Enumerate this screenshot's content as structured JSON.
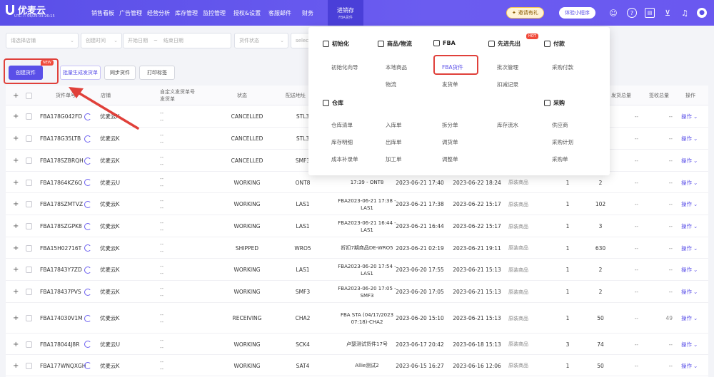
{
  "header": {
    "brand": "优麦云",
    "subtitle": "UTC-7: 06/26 03:26:15",
    "nav": [
      {
        "label": "销售看板"
      },
      {
        "label": "广告管理"
      },
      {
        "label": "经营分析"
      },
      {
        "label": "库存管理"
      },
      {
        "label": "监控管理"
      },
      {
        "label": "授权&设置"
      },
      {
        "label": "客服邮件"
      },
      {
        "label": "财务"
      }
    ],
    "active_nav": {
      "label": "进销存",
      "sub": "FBA货件"
    },
    "invite_label": "邀请有礼",
    "trial_label": "体验小程序"
  },
  "filters": [
    {
      "placeholder": "请选择店铺"
    },
    {
      "placeholder": "创建时间"
    },
    {
      "placeholder": "开始日期"
    },
    {
      "placeholder": "结束日期"
    },
    {
      "placeholder": "货件状态"
    },
    {
      "placeholder": "selec"
    }
  ],
  "toolbar": {
    "create_label": "创建货件",
    "new_badge": "NEW",
    "batch_label": "批量生成发货单",
    "sync_label": "同步货件",
    "print_label": "打印标签"
  },
  "table": {
    "headers": {
      "shipment_no": "货件单号",
      "store": "店铺",
      "custom": "自定义发货单号",
      "ship_no": "发货单",
      "status": "状态",
      "dest": "配送地址",
      "ship_total": "发货总量",
      "recv_total": "签收总量",
      "ops": "操作"
    },
    "rows": [
      {
        "id": "FBA178G042FD",
        "store": "优麦云K",
        "status": "CANCELLED",
        "dest": "STL3",
        "name": "",
        "created": "",
        "updated": "",
        "type": "",
        "c1": "",
        "c2": "",
        "ship": "--",
        "recv": "--"
      },
      {
        "id": "FBA178G35LTB",
        "store": "优麦云K",
        "status": "CANCELLED",
        "dest": "STL3",
        "name": "",
        "created": "",
        "updated": "",
        "type": "",
        "c1": "",
        "c2": "",
        "ship": "--",
        "recv": "--"
      },
      {
        "id": "FBA178SZBRQH",
        "store": "优麦云K",
        "status": "CANCELLED",
        "dest": "SMF3",
        "name": "",
        "created": "",
        "updated": "",
        "type": "",
        "c1": "",
        "c2": "",
        "ship": "--",
        "recv": "--"
      },
      {
        "id": "FBA17864KZ6Q",
        "store": "优麦云U",
        "status": "WORKING",
        "dest": "ONT8",
        "name": "17:39 - ONT8",
        "created": "2023-06-21 17:40",
        "updated": "2023-06-22 18:24",
        "type": "原装商品",
        "c1": "1",
        "c2": "2",
        "ship": "--",
        "recv": "--"
      },
      {
        "id": "FBA178SZMTVZ",
        "store": "优麦云K",
        "status": "WORKING",
        "dest": "LAS1",
        "name": "FBA2023-06-21 17:38 - LAS1",
        "created": "2023-06-21 17:38",
        "updated": "2023-06-22 15:17",
        "type": "原装商品",
        "c1": "1",
        "c2": "102",
        "ship": "--",
        "recv": "--"
      },
      {
        "id": "FBA178SZGPK8",
        "store": "优麦云K",
        "status": "WORKING",
        "dest": "LAS1",
        "name": "FBA2023-06-21 16:44 - LAS1",
        "created": "2023-06-21 16:44",
        "updated": "2023-06-22 15:17",
        "type": "原装商品",
        "c1": "1",
        "c2": "3",
        "ship": "--",
        "recv": "--"
      },
      {
        "id": "FBA15H02716T",
        "store": "优麦云K",
        "status": "SHIPPED",
        "dest": "WRO5",
        "name": "折扣7期商品DE-WRO5",
        "created": "2023-06-21 02:19",
        "updated": "2023-06-21 19:11",
        "type": "原装商品",
        "c1": "1",
        "c2": "630",
        "ship": "--",
        "recv": "--"
      },
      {
        "id": "FBA17843Y7ZD",
        "store": "优麦云K",
        "status": "WORKING",
        "dest": "LAS1",
        "name": "FBA2023-06-20 17:54 - LAS1",
        "created": "2023-06-20 17:55",
        "updated": "2023-06-21 15:13",
        "type": "原装商品",
        "c1": "1",
        "c2": "2",
        "ship": "--",
        "recv": "--"
      },
      {
        "id": "FBA178437PVS",
        "store": "优麦云K",
        "status": "WORKING",
        "dest": "SMF3",
        "name": "FBA2023-06-20 17:05 - SMF3",
        "created": "2023-06-20 17:05",
        "updated": "2023-06-21 15:13",
        "type": "原装商品",
        "c1": "1",
        "c2": "2",
        "ship": "--",
        "recv": "--"
      },
      {
        "id": "FBA174030V1M",
        "store": "优麦云K",
        "status": "RECEIVING",
        "dest": "CHA2",
        "name": "FBA STA (04/17/2023 07:18)-CHA2",
        "created": "2023-06-20 15:10",
        "updated": "2023-06-21 15:13",
        "type": "原装商品",
        "c1": "1",
        "c2": "50",
        "ship": "--",
        "recv": "49"
      },
      {
        "id": "FBA178044J8R",
        "store": "优麦云U",
        "status": "WORKING",
        "dest": "SCK4",
        "name": "卢瑟测试货件17号",
        "created": "2023-06-17 20:42",
        "updated": "2023-06-18 15:13",
        "type": "原装商品",
        "c1": "3",
        "c2": "74",
        "ship": "--",
        "recv": "--"
      },
      {
        "id": "FBA177WNQXGH",
        "store": "优麦云K",
        "status": "WORKING",
        "dest": "SAT4",
        "name": "Allie测试2",
        "created": "2023-06-15 16:27",
        "updated": "2023-06-16 12:06",
        "type": "原装商品",
        "c1": "1",
        "c2": "50",
        "ship": "--",
        "recv": "--"
      }
    ],
    "op_label": "操作"
  },
  "dropdown": {
    "sections": {
      "init": {
        "title": "初始化",
        "items": [
          "初始化向导"
        ]
      },
      "goods": {
        "title": "商品/物流",
        "items": [
          "本地商品",
          "物流"
        ]
      },
      "fba": {
        "title": "FBA",
        "items": [
          "FBA货件",
          "发货单"
        ]
      },
      "fifo": {
        "title": "先进先出",
        "items": [
          "批次管理",
          "扣减记录"
        ]
      },
      "pay": {
        "title": "付款",
        "items": [
          "采购付款"
        ]
      },
      "warehouse": {
        "title": "仓库",
        "items": [
          "仓库清单",
          "入库单",
          "拆分单",
          "库存流水",
          "库存明细",
          "出库单",
          "调货单",
          "成本补录单",
          "加工单",
          "调整单"
        ]
      },
      "purchase": {
        "title": "采购",
        "items": [
          "供应商",
          "采购计划",
          "采购单"
        ]
      }
    },
    "hot_badge": "HOT"
  },
  "colors": {
    "primary": "#5a4fe8",
    "highlight": "#e0403a"
  }
}
